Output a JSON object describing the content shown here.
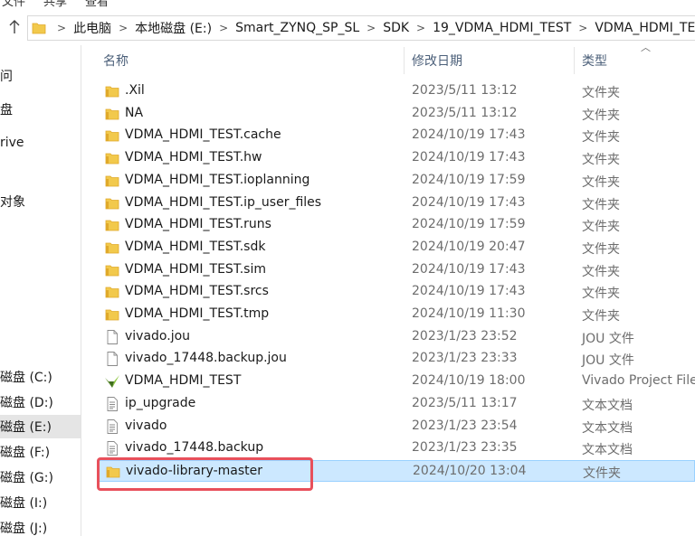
{
  "menu": {
    "items": [
      "文件",
      "共享",
      "查看"
    ]
  },
  "address_bar": {
    "breadcrumbs": [
      "此电脑",
      "本地磁盘 (E:)",
      "Smart_ZYNQ_SP_SL",
      "SDK",
      "19_VDMA_HDMI_TEST",
      "VDMA_HDMI_TEST"
    ]
  },
  "sidebar": {
    "items": [
      {
        "label": "问",
        "selected": false
      },
      {
        "label": "盘",
        "selected": false
      },
      {
        "label": "rive",
        "selected": false
      },
      {
        "label": "对象",
        "selected": false
      },
      {
        "label": "磁盘 (C:)",
        "selected": false
      },
      {
        "label": "磁盘 (D:)",
        "selected": false
      },
      {
        "label": "磁盘 (E:)",
        "selected": true
      },
      {
        "label": "磁盘 (F:)",
        "selected": false
      },
      {
        "label": "磁盘 (G:)",
        "selected": false
      },
      {
        "label": "磁盘 (I:)",
        "selected": false
      },
      {
        "label": "磁盘 (J:)",
        "selected": false
      }
    ]
  },
  "columns": {
    "name": "名称",
    "date": "修改日期",
    "type": "类型"
  },
  "files": [
    {
      "name": ".Xil",
      "date": "2023/5/11 13:12",
      "type": "文件夹",
      "icon": "folder-icon"
    },
    {
      "name": "NA",
      "date": "2023/5/11 13:12",
      "type": "文件夹",
      "icon": "folder-icon"
    },
    {
      "name": "VDMA_HDMI_TEST.cache",
      "date": "2024/10/19 17:43",
      "type": "文件夹",
      "icon": "folder-icon"
    },
    {
      "name": "VDMA_HDMI_TEST.hw",
      "date": "2024/10/19 17:43",
      "type": "文件夹",
      "icon": "folder-icon"
    },
    {
      "name": "VDMA_HDMI_TEST.ioplanning",
      "date": "2024/10/19 17:59",
      "type": "文件夹",
      "icon": "folder-icon"
    },
    {
      "name": "VDMA_HDMI_TEST.ip_user_files",
      "date": "2024/10/19 17:43",
      "type": "文件夹",
      "icon": "folder-icon"
    },
    {
      "name": "VDMA_HDMI_TEST.runs",
      "date": "2024/10/19 17:59",
      "type": "文件夹",
      "icon": "folder-icon"
    },
    {
      "name": "VDMA_HDMI_TEST.sdk",
      "date": "2024/10/19 20:47",
      "type": "文件夹",
      "icon": "folder-icon"
    },
    {
      "name": "VDMA_HDMI_TEST.sim",
      "date": "2024/10/19 17:43",
      "type": "文件夹",
      "icon": "folder-icon"
    },
    {
      "name": "VDMA_HDMI_TEST.srcs",
      "date": "2024/10/19 17:43",
      "type": "文件夹",
      "icon": "folder-icon"
    },
    {
      "name": "VDMA_HDMI_TEST.tmp",
      "date": "2024/10/19 11:30",
      "type": "文件夹",
      "icon": "folder-icon"
    },
    {
      "name": "vivado.jou",
      "date": "2023/1/23 23:52",
      "type": "JOU 文件",
      "icon": "blank-file-icon"
    },
    {
      "name": "vivado_17448.backup.jou",
      "date": "2023/1/23 23:33",
      "type": "JOU 文件",
      "icon": "blank-file-icon"
    },
    {
      "name": "VDMA_HDMI_TEST",
      "date": "2024/10/19 18:00",
      "type": "Vivado Project File",
      "icon": "vivado-project-icon"
    },
    {
      "name": "ip_upgrade",
      "date": "2023/5/11 13:17",
      "type": "文本文档",
      "icon": "text-file-icon"
    },
    {
      "name": "vivado",
      "date": "2023/1/23 23:54",
      "type": "文本文档",
      "icon": "text-file-icon"
    },
    {
      "name": "vivado_17448.backup",
      "date": "2023/1/23 23:35",
      "type": "文本文档",
      "icon": "text-file-icon"
    },
    {
      "name": "vivado-library-master",
      "date": "2024/10/20 13:04",
      "type": "文件夹",
      "icon": "folder-icon",
      "selected": true
    }
  ],
  "colors": {
    "folder": "#f2c94c",
    "folder_dark": "#e0a92a",
    "selection_bg": "#cce8ff",
    "selection_border": "#99d1ff",
    "highlight": "#e8505b",
    "header_text": "#4c607a"
  }
}
